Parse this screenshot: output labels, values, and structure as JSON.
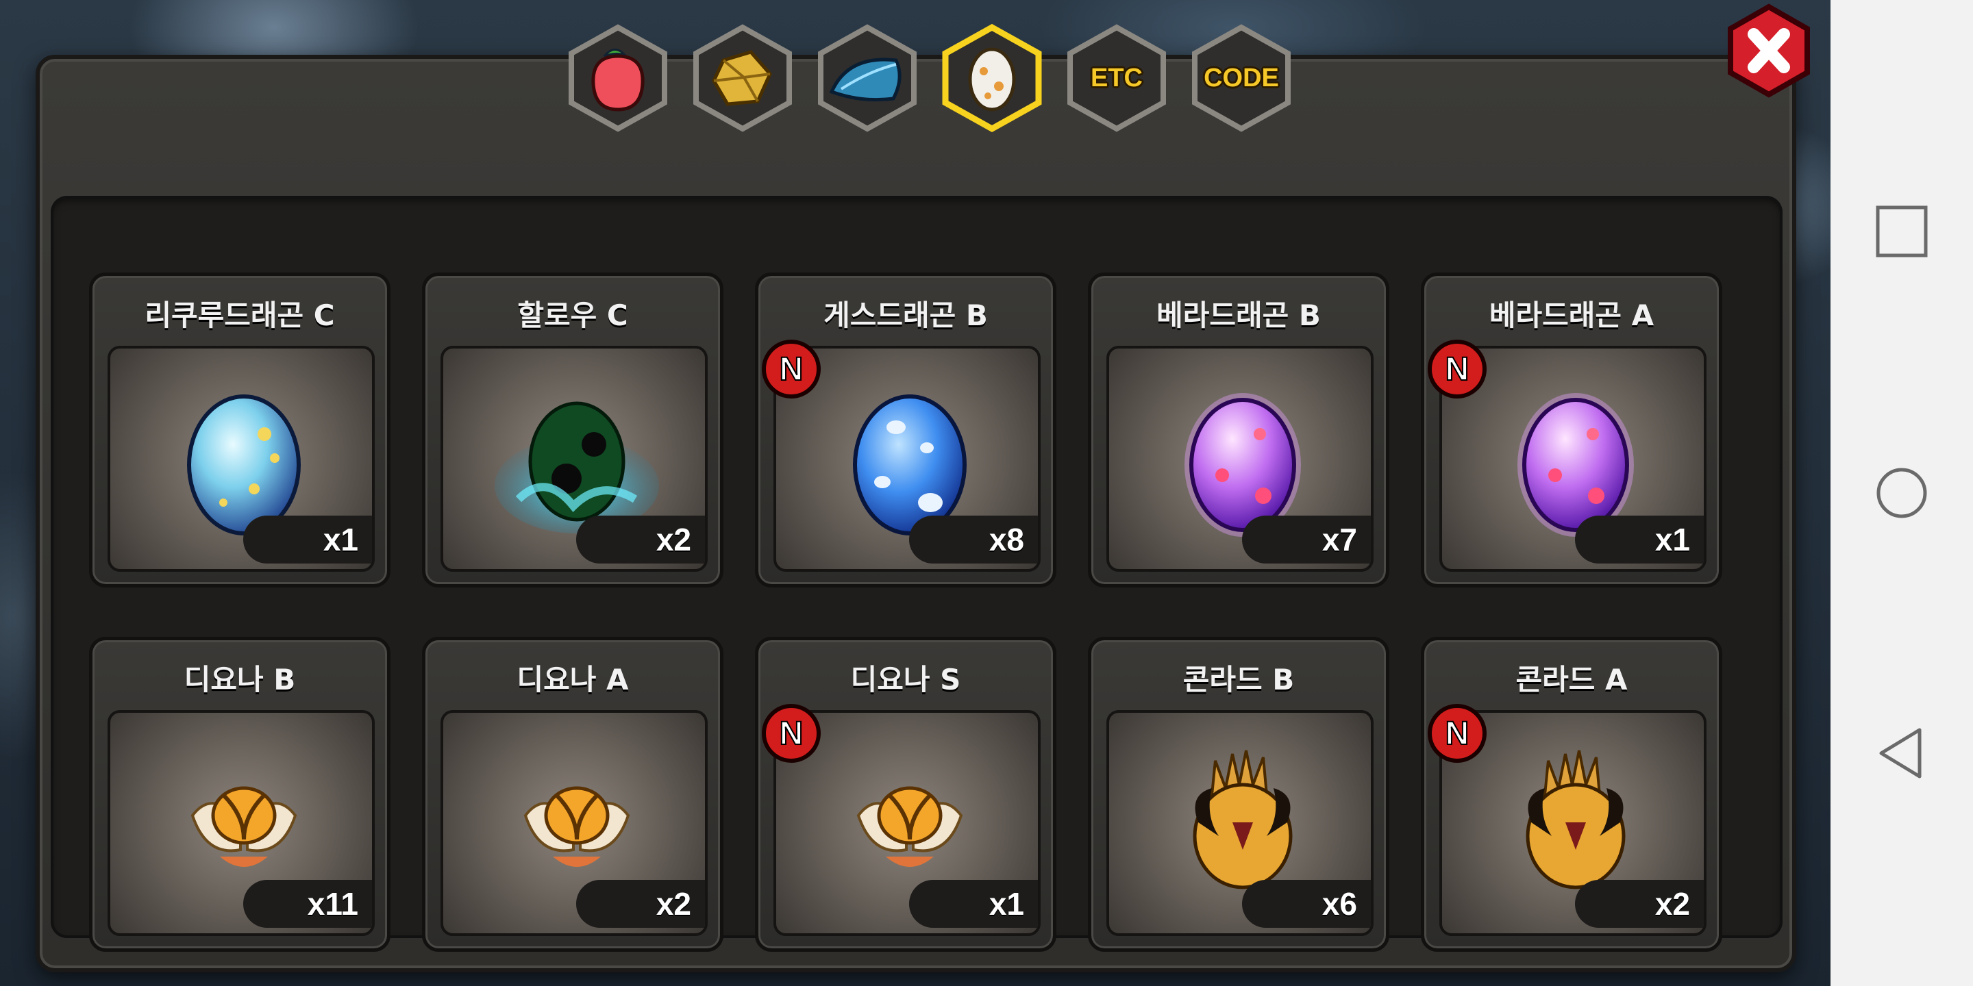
{
  "tabs": [
    {
      "id": "fruit",
      "icon": "red-fruit-icon",
      "label": ""
    },
    {
      "id": "gold",
      "icon": "gold-ore-icon",
      "label": ""
    },
    {
      "id": "feather",
      "icon": "blue-feather-icon",
      "label": ""
    },
    {
      "id": "egg",
      "icon": "egg-icon",
      "label": "",
      "active": true
    },
    {
      "id": "etc",
      "icon": "",
      "label": "ETC"
    },
    {
      "id": "code",
      "icon": "",
      "label": "CODE"
    }
  ],
  "items": [
    {
      "name": "리쿠루드래곤 C",
      "qty": "x1",
      "new": false,
      "egg": "blue-yellow"
    },
    {
      "name": "할로우 C",
      "qty": "x2",
      "new": false,
      "egg": "dark-green"
    },
    {
      "name": "게스드래곤 B",
      "qty": "x8",
      "new": true,
      "egg": "blue-white"
    },
    {
      "name": "베라드래곤 B",
      "qty": "x7",
      "new": false,
      "egg": "purple"
    },
    {
      "name": "베라드래곤 A",
      "qty": "x1",
      "new": true,
      "egg": "purple"
    },
    {
      "name": "디요나 B",
      "qty": "x11",
      "new": false,
      "egg": "winged-gold"
    },
    {
      "name": "디요나 A",
      "qty": "x2",
      "new": false,
      "egg": "winged-gold"
    },
    {
      "name": "디요나 S",
      "qty": "x1",
      "new": true,
      "egg": "winged-gold"
    },
    {
      "name": "콘라드 B",
      "qty": "x6",
      "new": false,
      "egg": "horned-gold"
    },
    {
      "name": "콘라드 A",
      "qty": "x2",
      "new": true,
      "egg": "horned-gold"
    }
  ],
  "badge_label": "N",
  "colors": {
    "accent": "#f7d21e",
    "new_badge": "#d31c1c",
    "close": "#d51f2a"
  }
}
